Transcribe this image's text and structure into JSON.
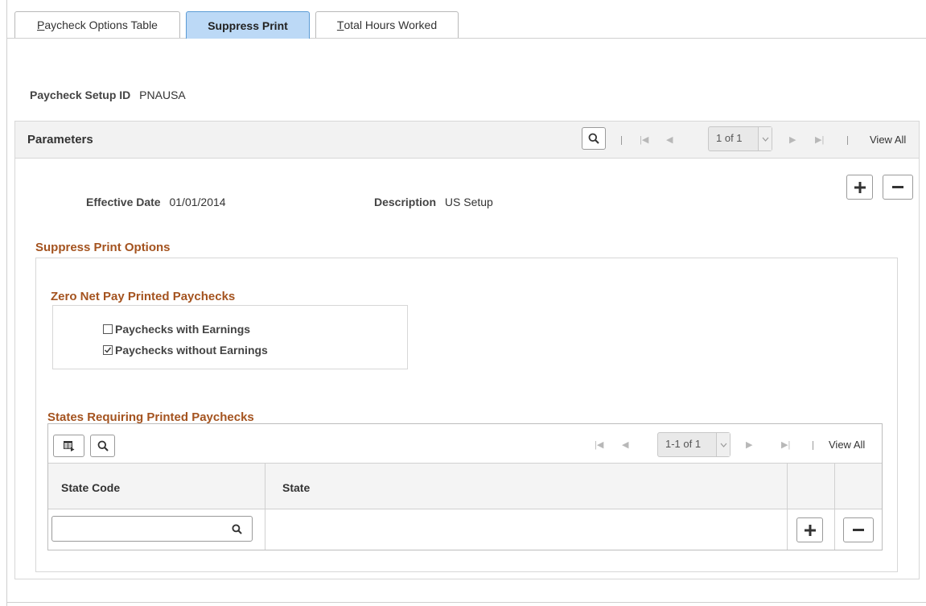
{
  "tabs": [
    {
      "prefix": "",
      "underline": "P",
      "rest": "aycheck Options Table",
      "active": false
    },
    {
      "prefix": "",
      "underline": "",
      "rest": "Suppress Print",
      "active": true
    },
    {
      "prefix": "",
      "underline": "T",
      "rest": "otal Hours Worked",
      "active": false
    }
  ],
  "setup": {
    "label": "Paycheck Setup ID",
    "value": "PNAUSA"
  },
  "parameters": {
    "title": "Parameters",
    "pager": "1 of 1",
    "view_all": "View All",
    "effective_date_label": "Effective Date",
    "effective_date_value": "01/01/2014",
    "description_label": "Description",
    "description_value": "US Setup"
  },
  "suppress": {
    "title": "Suppress Print Options",
    "zero_net_title": "Zero Net Pay Printed Paychecks",
    "with_earnings": {
      "label": "Paychecks with Earnings",
      "checked": false
    },
    "without_earnings": {
      "label": "Paychecks without Earnings",
      "checked": true
    }
  },
  "states": {
    "title": "States Requiring Printed Paychecks",
    "pager": "1-1 of 1",
    "view_all": "View All",
    "columns": [
      "State Code",
      "State"
    ],
    "row": {
      "state_code": "",
      "state": ""
    }
  },
  "colors": {
    "section_title": "#a4531f",
    "active_tab": "#bcd9f6",
    "active_tab_border": "#5b9bd5"
  }
}
